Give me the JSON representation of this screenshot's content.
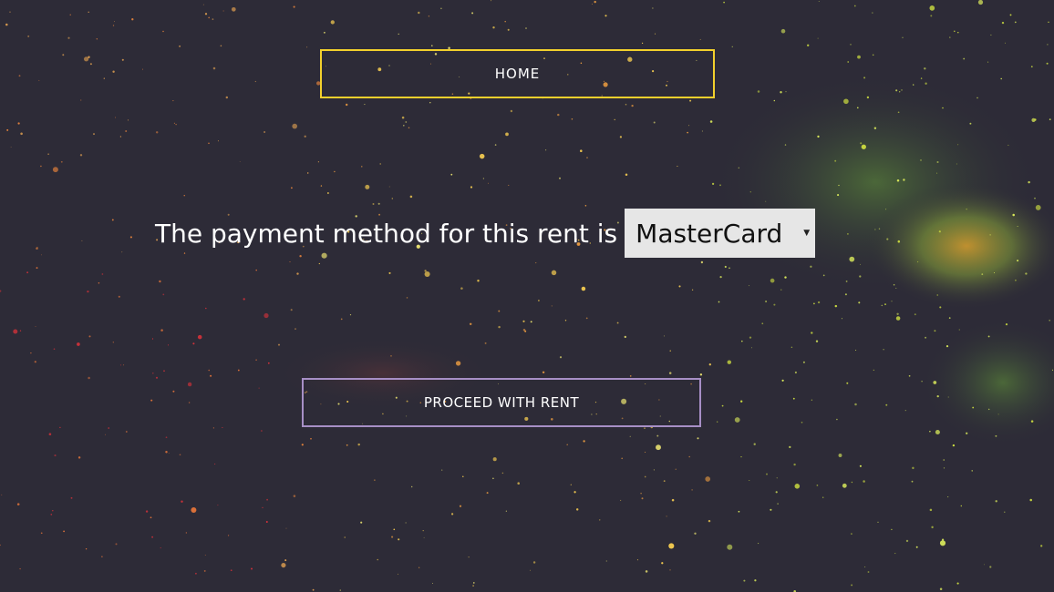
{
  "nav": {
    "home_label": "HOME"
  },
  "payment": {
    "prompt": "The payment method for this rent is",
    "selected_method": "MasterCard"
  },
  "actions": {
    "proceed_label": "PROCEED WITH RENT"
  },
  "colors": {
    "background": "#2d2b37",
    "home_border": "#f2d02c",
    "proceed_border": "#a78fc6",
    "select_bg": "#e6e6e6"
  },
  "icons": {
    "select_caret": "caret-down-icon"
  }
}
